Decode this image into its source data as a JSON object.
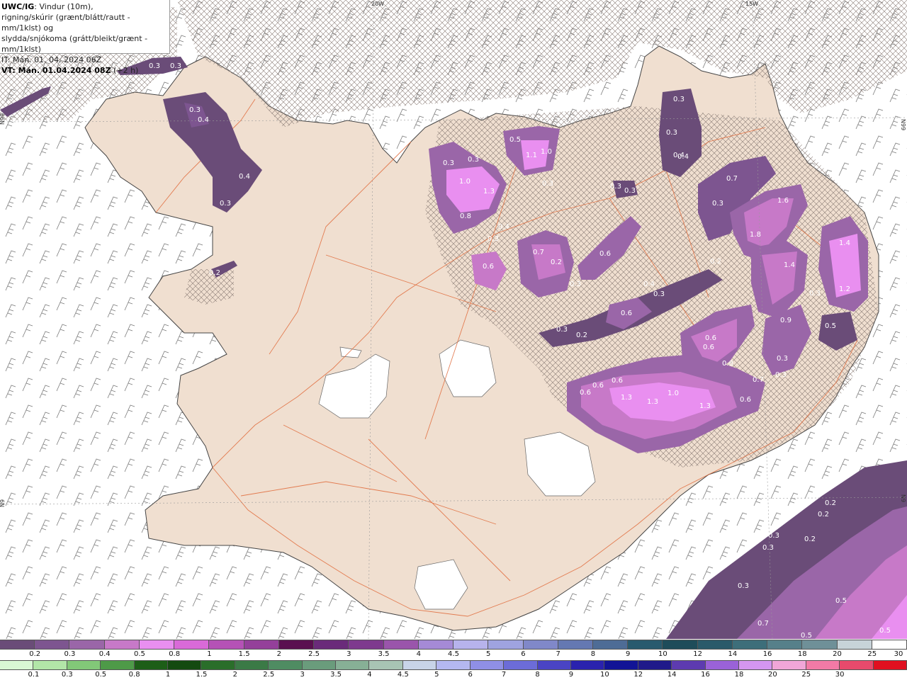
{
  "header": {
    "model": "UWC/IG",
    "line1_rest": ": Vindur (10m),",
    "line2": "rigning/skúrir (grænt/blátt/rautt - mm/1klst) og",
    "line3": "slydda/snjókoma (grátt/bleikt/grænt - mm/1klst)",
    "line4": "IT: Mán. 01. 04. 2024 06Z",
    "vt_label": "VT: Mán. 01.04.2024 08Z",
    "vt_offset": " (+2 h)"
  },
  "grid_labels": {
    "lon_20w": "20W",
    "lon_15w": "15W",
    "lat_left": "N99",
    "lat_right": "N99",
    "lat_left2": "N9",
    "lat_right2": "N9"
  },
  "precip_labels": [
    {
      "text": "0.3"
    },
    {
      "text": "0.3"
    },
    {
      "text": "0.3"
    },
    {
      "text": "0.4"
    },
    {
      "text": "0.4"
    },
    {
      "text": "0.4"
    },
    {
      "text": "0.3"
    },
    {
      "text": "0.2"
    },
    {
      "text": "0.3"
    },
    {
      "text": "0.3"
    },
    {
      "text": "1.0"
    },
    {
      "text": "1.3"
    },
    {
      "text": "0.8"
    },
    {
      "text": "0.5"
    },
    {
      "text": "1.1"
    },
    {
      "text": "1.0"
    },
    {
      "text": "0.3"
    },
    {
      "text": "0.3"
    },
    {
      "text": "0.4"
    },
    {
      "text": "0.3"
    },
    {
      "text": "0.3"
    },
    {
      "text": "0.4"
    },
    {
      "text": "0.3"
    },
    {
      "text": "0.3"
    },
    {
      "text": "0.6"
    },
    {
      "text": "0.7"
    },
    {
      "text": "0.2"
    },
    {
      "text": "0.3"
    },
    {
      "text": "0.6"
    },
    {
      "text": "0.4"
    },
    {
      "text": "0.3"
    },
    {
      "text": "0.6"
    },
    {
      "text": "0.3"
    },
    {
      "text": "0.2"
    },
    {
      "text": "0.7"
    },
    {
      "text": "0.3"
    },
    {
      "text": "1.6"
    },
    {
      "text": "1.8"
    },
    {
      "text": "1.4"
    },
    {
      "text": "0.2"
    },
    {
      "text": "1.4"
    },
    {
      "text": "1.2"
    },
    {
      "text": "0.3"
    },
    {
      "text": "0.9"
    },
    {
      "text": "0.5"
    },
    {
      "text": "0.6"
    },
    {
      "text": "0.6"
    },
    {
      "text": "0.8"
    },
    {
      "text": "0.3"
    },
    {
      "text": "0.3"
    },
    {
      "text": "0.7"
    },
    {
      "text": "0.6"
    },
    {
      "text": "0.6"
    },
    {
      "text": "0.6"
    },
    {
      "text": "1.3"
    },
    {
      "text": "1.0"
    },
    {
      "text": "1.3"
    },
    {
      "text": "1.3"
    },
    {
      "text": "0.6"
    },
    {
      "text": "0.2"
    },
    {
      "text": "0.2"
    },
    {
      "text": "0.3"
    },
    {
      "text": "0.2"
    },
    {
      "text": "0.3"
    },
    {
      "text": "0.3"
    },
    {
      "text": "0.5"
    },
    {
      "text": "0.7"
    },
    {
      "text": "0.5"
    },
    {
      "text": "0.5"
    }
  ],
  "legend_snow": {
    "colors": [
      "#6a4c78",
      "#7d5590",
      "#9a66a8",
      "#c779c8",
      "#e98ff0",
      "#d96ad8",
      "#b552b6",
      "#94409a",
      "#5a1050",
      "#6a2b7a",
      "#7e3a8e",
      "#9a55ab",
      "#a58ad6",
      "#b7b3ec",
      "#9fa3e0",
      "#8088c9",
      "#6478b2",
      "#4e6c96",
      "#285a6e",
      "#1e4c5a",
      "#2a5a6a",
      "#3d6e7a",
      "#56808a",
      "#6f9098",
      "#c7d3d8",
      "#ffffff"
    ],
    "ticks": [
      "0.2",
      "0.3",
      "0.4",
      "0.5",
      "0.8",
      "1",
      "1.5",
      "2",
      "2.5",
      "3",
      "3.5",
      "4",
      "4.5",
      "5",
      "6",
      "7",
      "8",
      "9",
      "10",
      "12",
      "14",
      "16",
      "18",
      "20",
      "25",
      "30"
    ]
  },
  "legend_rain": {
    "colors": [
      "#d9f7d4",
      "#b2e6a8",
      "#82c878",
      "#4e9a48",
      "#1d5e17",
      "#144a10",
      "#2a6e2a",
      "#3b7a46",
      "#4f8c62",
      "#6a9c7c",
      "#87b096",
      "#a8c4b4",
      "#c8d4e8",
      "#b4b8f0",
      "#8f8fe6",
      "#6c6cd8",
      "#4a44c4",
      "#2a22ae",
      "#121496",
      "#201a8a",
      "#5d3bb0",
      "#9a62d8",
      "#d496f0",
      "#f0a6d8",
      "#f27aa6",
      "#e84a6c",
      "#e01020"
    ],
    "ticks": [
      "0.1",
      "0.3",
      "0.5",
      "0.8",
      "1",
      "1.5",
      "2",
      "2.5",
      "3",
      "3.5",
      "4",
      "4.5",
      "5",
      "6",
      "7",
      "8",
      "9",
      "10",
      "12",
      "14",
      "16",
      "18",
      "20",
      "25",
      "30"
    ]
  }
}
